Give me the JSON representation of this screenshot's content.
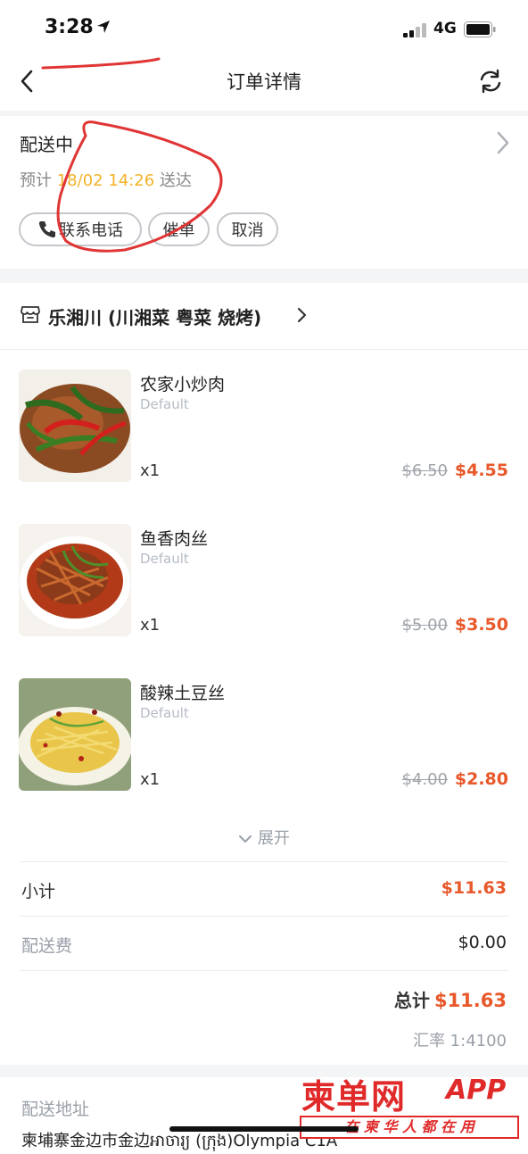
{
  "status_bar": {
    "time": "3:28",
    "network": "4G",
    "icons": [
      "location-arrow-icon",
      "signal-icon",
      "battery-icon"
    ]
  },
  "nav": {
    "title": "订单详情",
    "back_icon": "chevron-left-icon",
    "refresh_icon": "refresh-icon"
  },
  "delivery": {
    "status": "配送中",
    "eta_prefix": "预计",
    "eta_time": "18/02 14:26",
    "eta_suffix": "送达",
    "buttons": {
      "call": "联系电话",
      "urge": "催单",
      "cancel": "取消"
    }
  },
  "store": {
    "name": "乐湘川 (川湘菜 粤菜 烧烤)"
  },
  "items": [
    {
      "name": "农家小炒肉",
      "variant": "Default",
      "qty": "x1",
      "old_price": "$6.50",
      "price": "$4.55"
    },
    {
      "name": "鱼香肉丝",
      "variant": "Default",
      "qty": "x1",
      "old_price": "$5.00",
      "price": "$3.50"
    },
    {
      "name": "酸辣土豆丝",
      "variant": "Default",
      "qty": "x1",
      "old_price": "$4.00",
      "price": "$2.80"
    }
  ],
  "expand_label": "展开",
  "summary": {
    "subtotal_label": "小计",
    "subtotal_value": "$11.63",
    "delivery_fee_label": "配送费",
    "delivery_fee_value": "$0.00",
    "total_label": "总计",
    "total_value": "$11.63",
    "exchange_rate": "汇率 1:4100"
  },
  "address": {
    "label": "配送地址",
    "line": "柬埔寨金边市金边អាចារ្យ (ក្រុង)Olympia C1A"
  },
  "watermark": {
    "brand": "柬单网",
    "app": "APP",
    "slogan": "在 柬 华 人 都 在 用"
  },
  "colors": {
    "accent": "#e8582a",
    "eta": "#f2b32a",
    "muted": "#9aa0a8"
  }
}
